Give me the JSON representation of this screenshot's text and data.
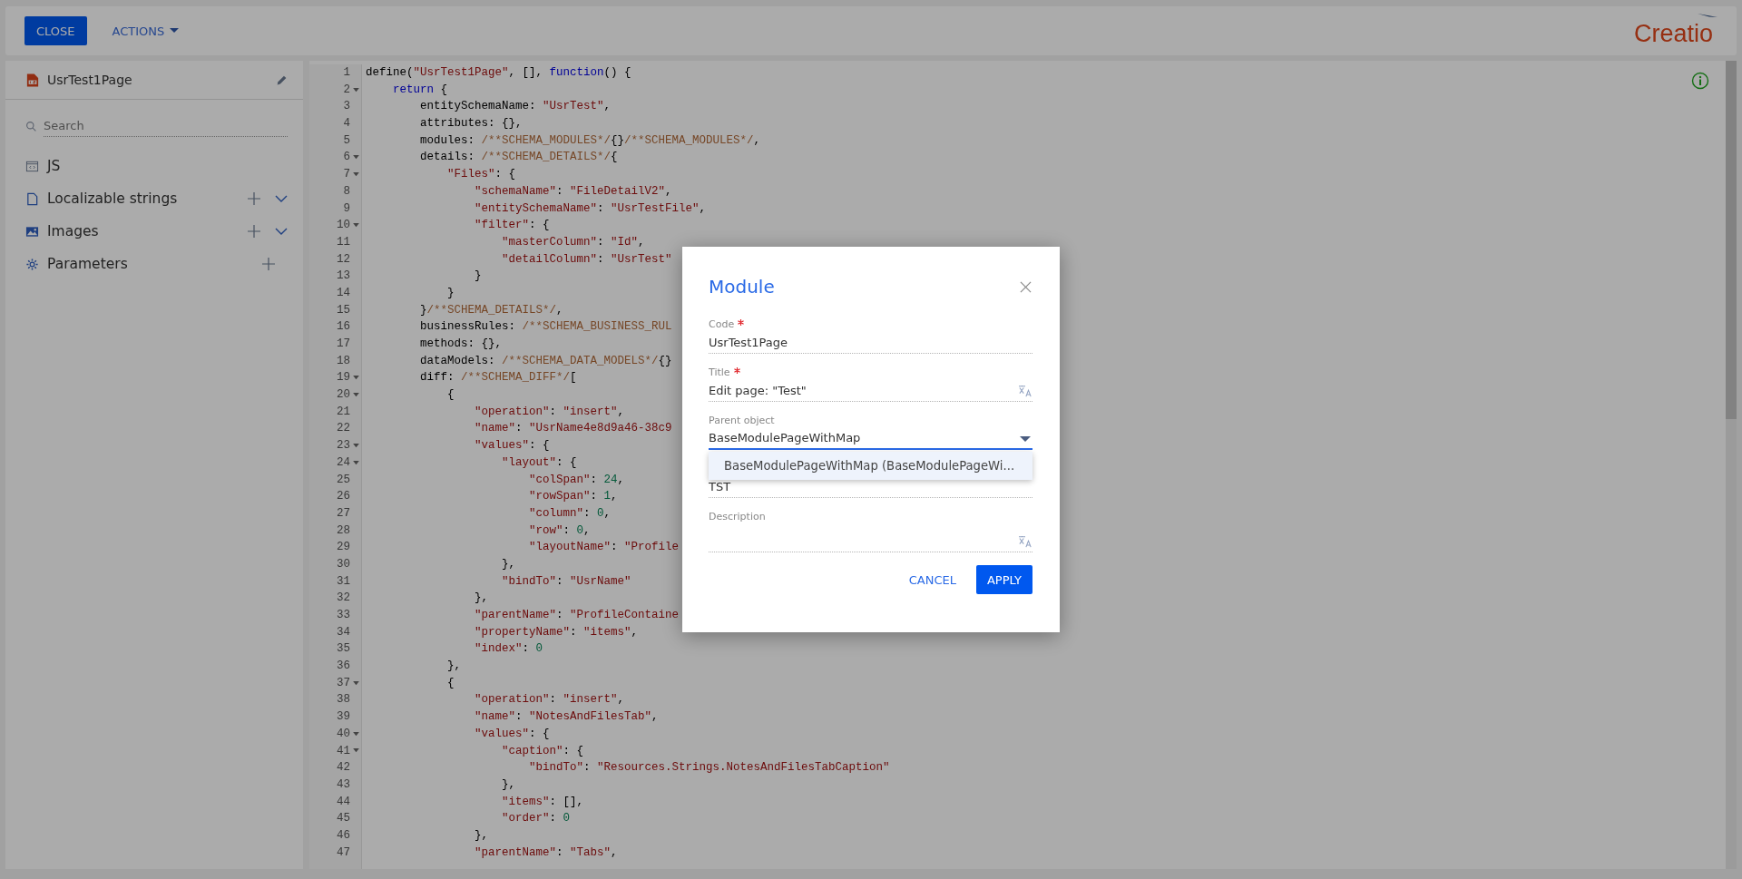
{
  "toolbar": {
    "close_button": "CLOSE",
    "actions_menu": "ACTIONS",
    "logo": "Creatio"
  },
  "sidebar": {
    "schema_name": "UsrTest1Page",
    "search": {
      "placeholder": "Search"
    },
    "items": [
      {
        "label": "JS",
        "kind": "code",
        "can_add": false,
        "expandable": false
      },
      {
        "label": "Localizable strings",
        "kind": "strings",
        "can_add": true,
        "expandable": true
      },
      {
        "label": "Images",
        "kind": "images",
        "can_add": true,
        "expandable": true
      },
      {
        "label": "Parameters",
        "kind": "parameters",
        "can_add": true,
        "expandable": false
      }
    ]
  },
  "editor": {
    "lines": [
      {
        "number": "1",
        "foldable": false,
        "segments": [
          {
            "kind": "plain",
            "text": "define("
          },
          {
            "kind": "string",
            "text": "\"UsrTest1Page\""
          },
          {
            "kind": "plain",
            "text": ", [], "
          },
          {
            "kind": "keyword",
            "text": "function"
          },
          {
            "kind": "plain",
            "text": "() {"
          }
        ]
      },
      {
        "number": "2",
        "foldable": true,
        "segments": [
          {
            "kind": "keyword",
            "text": "    return"
          },
          {
            "kind": "plain",
            "text": " {"
          }
        ]
      },
      {
        "number": "3",
        "foldable": false,
        "segments": [
          {
            "kind": "plain",
            "text": "        entitySchemaName: "
          },
          {
            "kind": "string",
            "text": "\"UsrTest\""
          },
          {
            "kind": "plain",
            "text": ","
          }
        ]
      },
      {
        "number": "4",
        "foldable": false,
        "segments": [
          {
            "kind": "plain",
            "text": "        attributes: {},"
          }
        ]
      },
      {
        "number": "5",
        "foldable": false,
        "segments": [
          {
            "kind": "plain",
            "text": "        modules: "
          },
          {
            "kind": "comment",
            "text": "/**SCHEMA_MODULES*/"
          },
          {
            "kind": "plain",
            "text": "{}"
          },
          {
            "kind": "comment",
            "text": "/**SCHEMA_MODULES*/"
          },
          {
            "kind": "plain",
            "text": ","
          }
        ]
      },
      {
        "number": "6",
        "foldable": true,
        "segments": [
          {
            "kind": "plain",
            "text": "        details: "
          },
          {
            "kind": "comment",
            "text": "/**SCHEMA_DETAILS*/"
          },
          {
            "kind": "plain",
            "text": "{"
          }
        ]
      },
      {
        "number": "7",
        "foldable": true,
        "segments": [
          {
            "kind": "string",
            "text": "            \"Files\""
          },
          {
            "kind": "plain",
            "text": ": {"
          }
        ]
      },
      {
        "number": "8",
        "foldable": false,
        "segments": [
          {
            "kind": "string",
            "text": "                \"schemaName\""
          },
          {
            "kind": "plain",
            "text": ": "
          },
          {
            "kind": "string",
            "text": "\"FileDetailV2\""
          },
          {
            "kind": "plain",
            "text": ","
          }
        ]
      },
      {
        "number": "9",
        "foldable": false,
        "segments": [
          {
            "kind": "string",
            "text": "                \"entitySchemaName\""
          },
          {
            "kind": "plain",
            "text": ": "
          },
          {
            "kind": "string",
            "text": "\"UsrTestFile\""
          },
          {
            "kind": "plain",
            "text": ","
          }
        ]
      },
      {
        "number": "10",
        "foldable": true,
        "segments": [
          {
            "kind": "string",
            "text": "                \"filter\""
          },
          {
            "kind": "plain",
            "text": ": {"
          }
        ]
      },
      {
        "number": "11",
        "foldable": false,
        "segments": [
          {
            "kind": "string",
            "text": "                    \"masterColumn\""
          },
          {
            "kind": "plain",
            "text": ": "
          },
          {
            "kind": "string",
            "text": "\"Id\""
          },
          {
            "kind": "plain",
            "text": ","
          }
        ]
      },
      {
        "number": "12",
        "foldable": false,
        "segments": [
          {
            "kind": "string",
            "text": "                    \"detailColumn\""
          },
          {
            "kind": "plain",
            "text": ": "
          },
          {
            "kind": "string",
            "text": "\"UsrTest\""
          }
        ]
      },
      {
        "number": "13",
        "foldable": false,
        "segments": [
          {
            "kind": "plain",
            "text": "                }"
          }
        ]
      },
      {
        "number": "14",
        "foldable": false,
        "segments": [
          {
            "kind": "plain",
            "text": "            }"
          }
        ]
      },
      {
        "number": "15",
        "foldable": false,
        "segments": [
          {
            "kind": "plain",
            "text": "        }"
          },
          {
            "kind": "comment",
            "text": "/**SCHEMA_DETAILS*/"
          },
          {
            "kind": "plain",
            "text": ","
          }
        ]
      },
      {
        "number": "16",
        "foldable": false,
        "segments": [
          {
            "kind": "plain",
            "text": "        businessRules: "
          },
          {
            "kind": "comment",
            "text": "/**SCHEMA_BUSINESS_RUL"
          }
        ]
      },
      {
        "number": "17",
        "foldable": false,
        "segments": [
          {
            "kind": "plain",
            "text": "        methods: {},"
          }
        ]
      },
      {
        "number": "18",
        "foldable": false,
        "segments": [
          {
            "kind": "plain",
            "text": "        dataModels: "
          },
          {
            "kind": "comment",
            "text": "/**SCHEMA_DATA_MODELS*/"
          },
          {
            "kind": "plain",
            "text": "{}"
          }
        ]
      },
      {
        "number": "19",
        "foldable": true,
        "segments": [
          {
            "kind": "plain",
            "text": "        diff: "
          },
          {
            "kind": "comment",
            "text": "/**SCHEMA_DIFF*/"
          },
          {
            "kind": "plain",
            "text": "["
          }
        ]
      },
      {
        "number": "20",
        "foldable": true,
        "segments": [
          {
            "kind": "plain",
            "text": "            {"
          }
        ]
      },
      {
        "number": "21",
        "foldable": false,
        "segments": [
          {
            "kind": "string",
            "text": "                \"operation\""
          },
          {
            "kind": "plain",
            "text": ": "
          },
          {
            "kind": "string",
            "text": "\"insert\""
          },
          {
            "kind": "plain",
            "text": ","
          }
        ]
      },
      {
        "number": "22",
        "foldable": false,
        "segments": [
          {
            "kind": "string",
            "text": "                \"name\""
          },
          {
            "kind": "plain",
            "text": ": "
          },
          {
            "kind": "string",
            "text": "\"UsrName4e8d9a46-38c9"
          }
        ]
      },
      {
        "number": "23",
        "foldable": true,
        "segments": [
          {
            "kind": "string",
            "text": "                \"values\""
          },
          {
            "kind": "plain",
            "text": ": {"
          }
        ]
      },
      {
        "number": "24",
        "foldable": true,
        "segments": [
          {
            "kind": "string",
            "text": "                    \"layout\""
          },
          {
            "kind": "plain",
            "text": ": {"
          }
        ]
      },
      {
        "number": "25",
        "foldable": false,
        "segments": [
          {
            "kind": "string",
            "text": "                        \"colSpan\""
          },
          {
            "kind": "plain",
            "text": ": "
          },
          {
            "kind": "number",
            "text": "24"
          },
          {
            "kind": "plain",
            "text": ","
          }
        ]
      },
      {
        "number": "26",
        "foldable": false,
        "segments": [
          {
            "kind": "string",
            "text": "                        \"rowSpan\""
          },
          {
            "kind": "plain",
            "text": ": "
          },
          {
            "kind": "number",
            "text": "1"
          },
          {
            "kind": "plain",
            "text": ","
          }
        ]
      },
      {
        "number": "27",
        "foldable": false,
        "segments": [
          {
            "kind": "string",
            "text": "                        \"column\""
          },
          {
            "kind": "plain",
            "text": ": "
          },
          {
            "kind": "number",
            "text": "0"
          },
          {
            "kind": "plain",
            "text": ","
          }
        ]
      },
      {
        "number": "28",
        "foldable": false,
        "segments": [
          {
            "kind": "string",
            "text": "                        \"row\""
          },
          {
            "kind": "plain",
            "text": ": "
          },
          {
            "kind": "number",
            "text": "0"
          },
          {
            "kind": "plain",
            "text": ","
          }
        ]
      },
      {
        "number": "29",
        "foldable": false,
        "segments": [
          {
            "kind": "string",
            "text": "                        \"layoutName\""
          },
          {
            "kind": "plain",
            "text": ": "
          },
          {
            "kind": "string",
            "text": "\"Profile"
          }
        ]
      },
      {
        "number": "30",
        "foldable": false,
        "segments": [
          {
            "kind": "plain",
            "text": "                    },"
          }
        ]
      },
      {
        "number": "31",
        "foldable": false,
        "segments": [
          {
            "kind": "string",
            "text": "                    \"bindTo\""
          },
          {
            "kind": "plain",
            "text": ": "
          },
          {
            "kind": "string",
            "text": "\"UsrName\""
          }
        ]
      },
      {
        "number": "32",
        "foldable": false,
        "segments": [
          {
            "kind": "plain",
            "text": "                },"
          }
        ]
      },
      {
        "number": "33",
        "foldable": false,
        "segments": [
          {
            "kind": "string",
            "text": "                \"parentName\""
          },
          {
            "kind": "plain",
            "text": ": "
          },
          {
            "kind": "string",
            "text": "\"ProfileContaine"
          }
        ]
      },
      {
        "number": "34",
        "foldable": false,
        "segments": [
          {
            "kind": "string",
            "text": "                \"propertyName\""
          },
          {
            "kind": "plain",
            "text": ": "
          },
          {
            "kind": "string",
            "text": "\"items\""
          },
          {
            "kind": "plain",
            "text": ","
          }
        ]
      },
      {
        "number": "35",
        "foldable": false,
        "segments": [
          {
            "kind": "string",
            "text": "                \"index\""
          },
          {
            "kind": "plain",
            "text": ": "
          },
          {
            "kind": "number",
            "text": "0"
          }
        ]
      },
      {
        "number": "36",
        "foldable": false,
        "segments": [
          {
            "kind": "plain",
            "text": "            },"
          }
        ]
      },
      {
        "number": "37",
        "foldable": true,
        "segments": [
          {
            "kind": "plain",
            "text": "            {"
          }
        ]
      },
      {
        "number": "38",
        "foldable": false,
        "segments": [
          {
            "kind": "string",
            "text": "                \"operation\""
          },
          {
            "kind": "plain",
            "text": ": "
          },
          {
            "kind": "string",
            "text": "\"insert\""
          },
          {
            "kind": "plain",
            "text": ","
          }
        ]
      },
      {
        "number": "39",
        "foldable": false,
        "segments": [
          {
            "kind": "string",
            "text": "                \"name\""
          },
          {
            "kind": "plain",
            "text": ": "
          },
          {
            "kind": "string",
            "text": "\"NotesAndFilesTab\""
          },
          {
            "kind": "plain",
            "text": ","
          }
        ]
      },
      {
        "number": "40",
        "foldable": true,
        "segments": [
          {
            "kind": "string",
            "text": "                \"values\""
          },
          {
            "kind": "plain",
            "text": ": {"
          }
        ]
      },
      {
        "number": "41",
        "foldable": true,
        "segments": [
          {
            "kind": "string",
            "text": "                    \"caption\""
          },
          {
            "kind": "plain",
            "text": ": {"
          }
        ]
      },
      {
        "number": "42",
        "foldable": false,
        "segments": [
          {
            "kind": "string",
            "text": "                        \"bindTo\""
          },
          {
            "kind": "plain",
            "text": ": "
          },
          {
            "kind": "string",
            "text": "\"Resources.Strings.NotesAndFilesTabCaption\""
          }
        ]
      },
      {
        "number": "43",
        "foldable": false,
        "segments": [
          {
            "kind": "plain",
            "text": "                    },"
          }
        ]
      },
      {
        "number": "44",
        "foldable": false,
        "segments": [
          {
            "kind": "string",
            "text": "                    \"items\""
          },
          {
            "kind": "plain",
            "text": ": [],"
          }
        ]
      },
      {
        "number": "45",
        "foldable": false,
        "segments": [
          {
            "kind": "string",
            "text": "                    \"order\""
          },
          {
            "kind": "plain",
            "text": ": "
          },
          {
            "kind": "number",
            "text": "0"
          }
        ]
      },
      {
        "number": "46",
        "foldable": false,
        "segments": [
          {
            "kind": "plain",
            "text": "                },"
          }
        ]
      },
      {
        "number": "47",
        "foldable": false,
        "segments": [
          {
            "kind": "string",
            "text": "                \"parentName\""
          },
          {
            "kind": "plain",
            "text": ": "
          },
          {
            "kind": "string",
            "text": "\"Tabs\""
          },
          {
            "kind": "plain",
            "text": ","
          }
        ]
      }
    ]
  },
  "dialog": {
    "title": "Module",
    "fields": [
      {
        "kind": "text",
        "label": "Code",
        "required": true,
        "value": "UsrTest1Page",
        "translatable": false,
        "focused": false
      },
      {
        "kind": "text",
        "label": "Title",
        "required": true,
        "value": "Edit page: \"Test\"",
        "translatable": true,
        "focused": false
      },
      {
        "kind": "lookup",
        "label": "Parent object",
        "required": false,
        "value": "BaseModulePageWithMap",
        "translatable": false,
        "focused": true,
        "options": [
          {
            "label": "BaseModulePageWithMap (BaseModulePageWi...",
            "highlighted": true
          }
        ]
      },
      {
        "kind": "text",
        "value": "TST",
        "required": false,
        "translatable": false,
        "focused": false
      },
      {
        "kind": "text",
        "label": "Description",
        "required": false,
        "translatable": true,
        "focused": false
      }
    ],
    "buttons": [
      {
        "label": "CANCEL",
        "kind": "secondary"
      },
      {
        "label": "APPLY",
        "kind": "primary"
      }
    ]
  }
}
